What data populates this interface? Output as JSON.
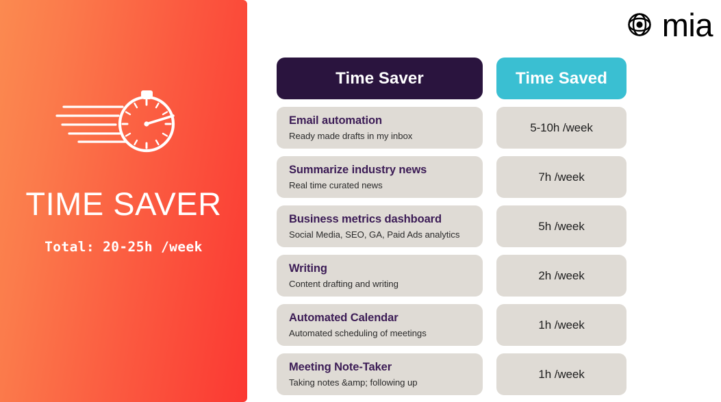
{
  "hero": {
    "icon": "stopwatch-speed-icon",
    "title": "TIME SAVER",
    "total": "Total: 20-25h /week",
    "gradient_from": "#FB8A50",
    "gradient_to": "#FB3832"
  },
  "logo": {
    "mark": "mia-eye-icon",
    "word": "mia",
    "color": "#000000"
  },
  "table": {
    "headers": {
      "left": "Time Saver",
      "right": "Time Saved",
      "left_bg": "#2A143E",
      "right_bg": "#3ABFD2"
    },
    "row_bg": "#DFDBD5",
    "title_color": "#3B1B55",
    "rows": [
      {
        "title": "Email automation",
        "desc": "Ready made drafts in my inbox",
        "time": "5-10h /week"
      },
      {
        "title": "Summarize industry news",
        "desc": "Real time curated news",
        "time": "7h /week"
      },
      {
        "title": "Business metrics dashboard",
        "desc": "Social Media, SEO, GA, Paid Ads analytics",
        "time": "5h /week"
      },
      {
        "title": "Writing",
        "desc": "Content drafting and writing",
        "time": "2h /week"
      },
      {
        "title": "Automated Calendar",
        "desc": "Automated scheduling of meetings",
        "time": "1h /week"
      },
      {
        "title": "Meeting Note-Taker",
        "desc": "Taking notes &amp; following up",
        "time": "1h /week"
      }
    ]
  }
}
